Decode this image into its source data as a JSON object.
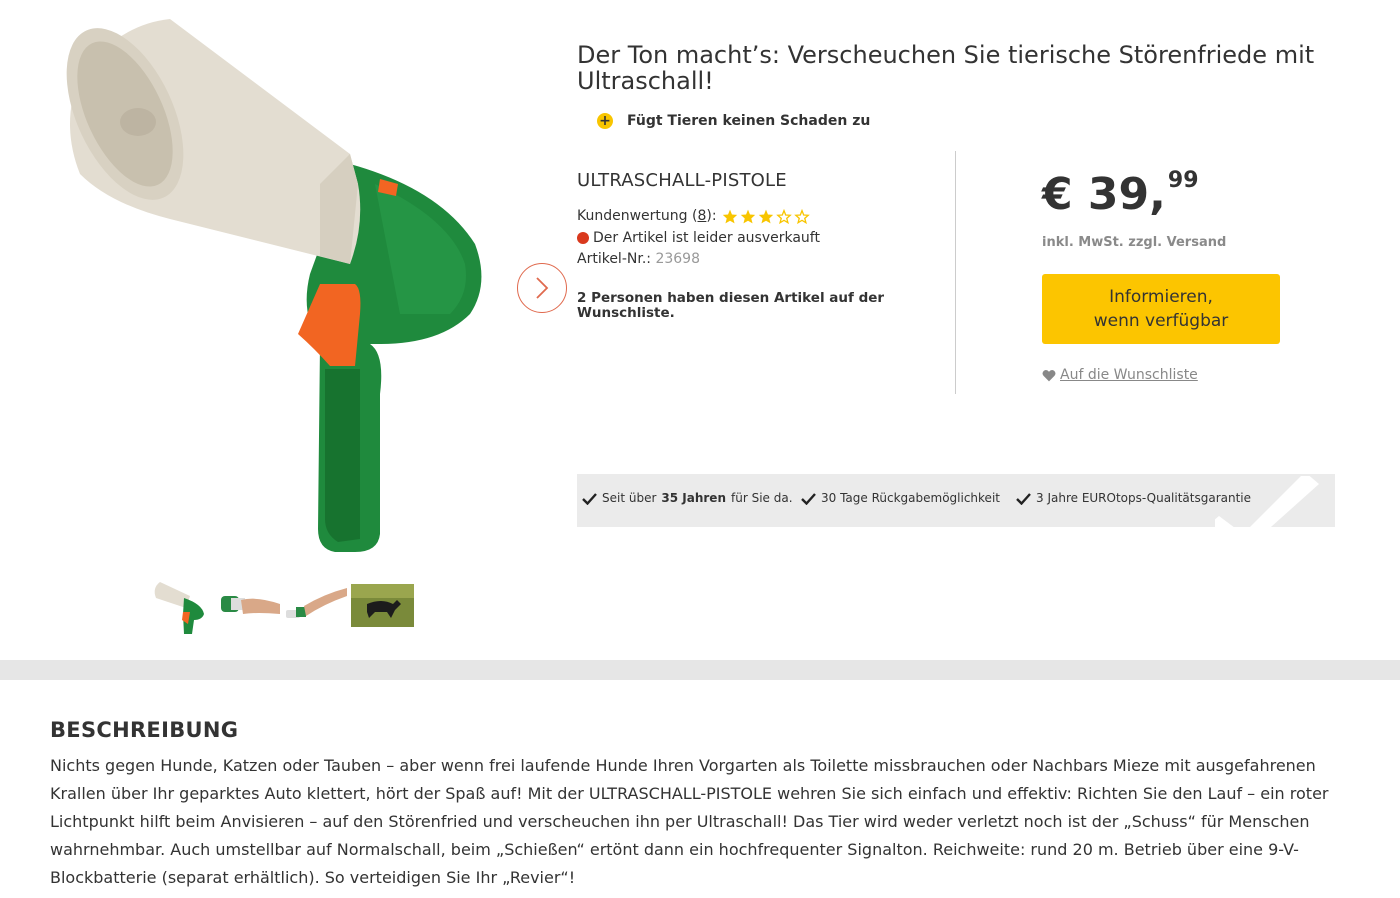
{
  "headline": "Der Ton macht’s: Verscheuchen Sie tierische Störenfriede mit Ultraschall!",
  "usp": {
    "icon": "plus-icon",
    "text": "Fügt Tieren keinen Schaden zu"
  },
  "product": {
    "name": "ULTRASCHALL-PISTOLE",
    "rating_label": "Kundenwertung (",
    "rating_count": "8",
    "rating_suffix": "):",
    "rating_stars": 3,
    "rating_max": 5,
    "stock_status": "Der Artikel ist leider ausverkauft",
    "artnr_label": "Artikel-Nr.:",
    "artnr_value": "23698",
    "wishlist_count_text": "2 Personen haben diesen Artikel auf der Wunschliste."
  },
  "price": {
    "main": "€ 39,",
    "cents": "99",
    "tax_note": "inkl. MwSt. zzgl. Versand"
  },
  "actions": {
    "notify_line1": "Informieren,",
    "notify_line2": "wenn verfügbar",
    "wishlist_link": "Auf die Wunschliste"
  },
  "trust": {
    "item1_pre": "Seit über",
    "item1_bold": "35 Jahren",
    "item1_post": "für Sie da.",
    "item2": "30 Tage Rückgabemöglichkeit",
    "item3": "3 Jahre EUROtops-Qualitätsgarantie"
  },
  "description": {
    "title": "BESCHREIBUNG",
    "text": "Nichts gegen Hunde, Katzen oder Tauben – aber wenn frei laufende Hunde Ihren Vorgarten als Toilette missbrauchen oder Nachbars Mieze mit ausgefahrenen Krallen über Ihr geparktes Auto klettert, hört der Spaß auf! Mit der ULTRASCHALL-PISTOLE wehren Sie sich einfach und effektiv: Richten Sie den Lauf – ein roter Lichtpunkt hilft beim Anvisieren – auf den Störenfried und verscheuchen ihn per Ultraschall! Das Tier wird weder verletzt noch ist der „Schuss“ für Menschen wahrnehmbar. Auch umstellbar auf Normalschall, beim „Schießen“ ertönt dann ein hochfrequenter Signalton. Reichweite: rund 20 m. Betrieb über eine 9-V-Blockbatterie (separat erhältlich). So verteidigen Sie Ihr „Revier“!"
  },
  "colors": {
    "accent_yellow": "#fcc500",
    "stock_red": "#d9391d",
    "arrow_orange": "#e06a4e",
    "device_green": "#1e8a3e",
    "device_orange": "#f26522"
  }
}
